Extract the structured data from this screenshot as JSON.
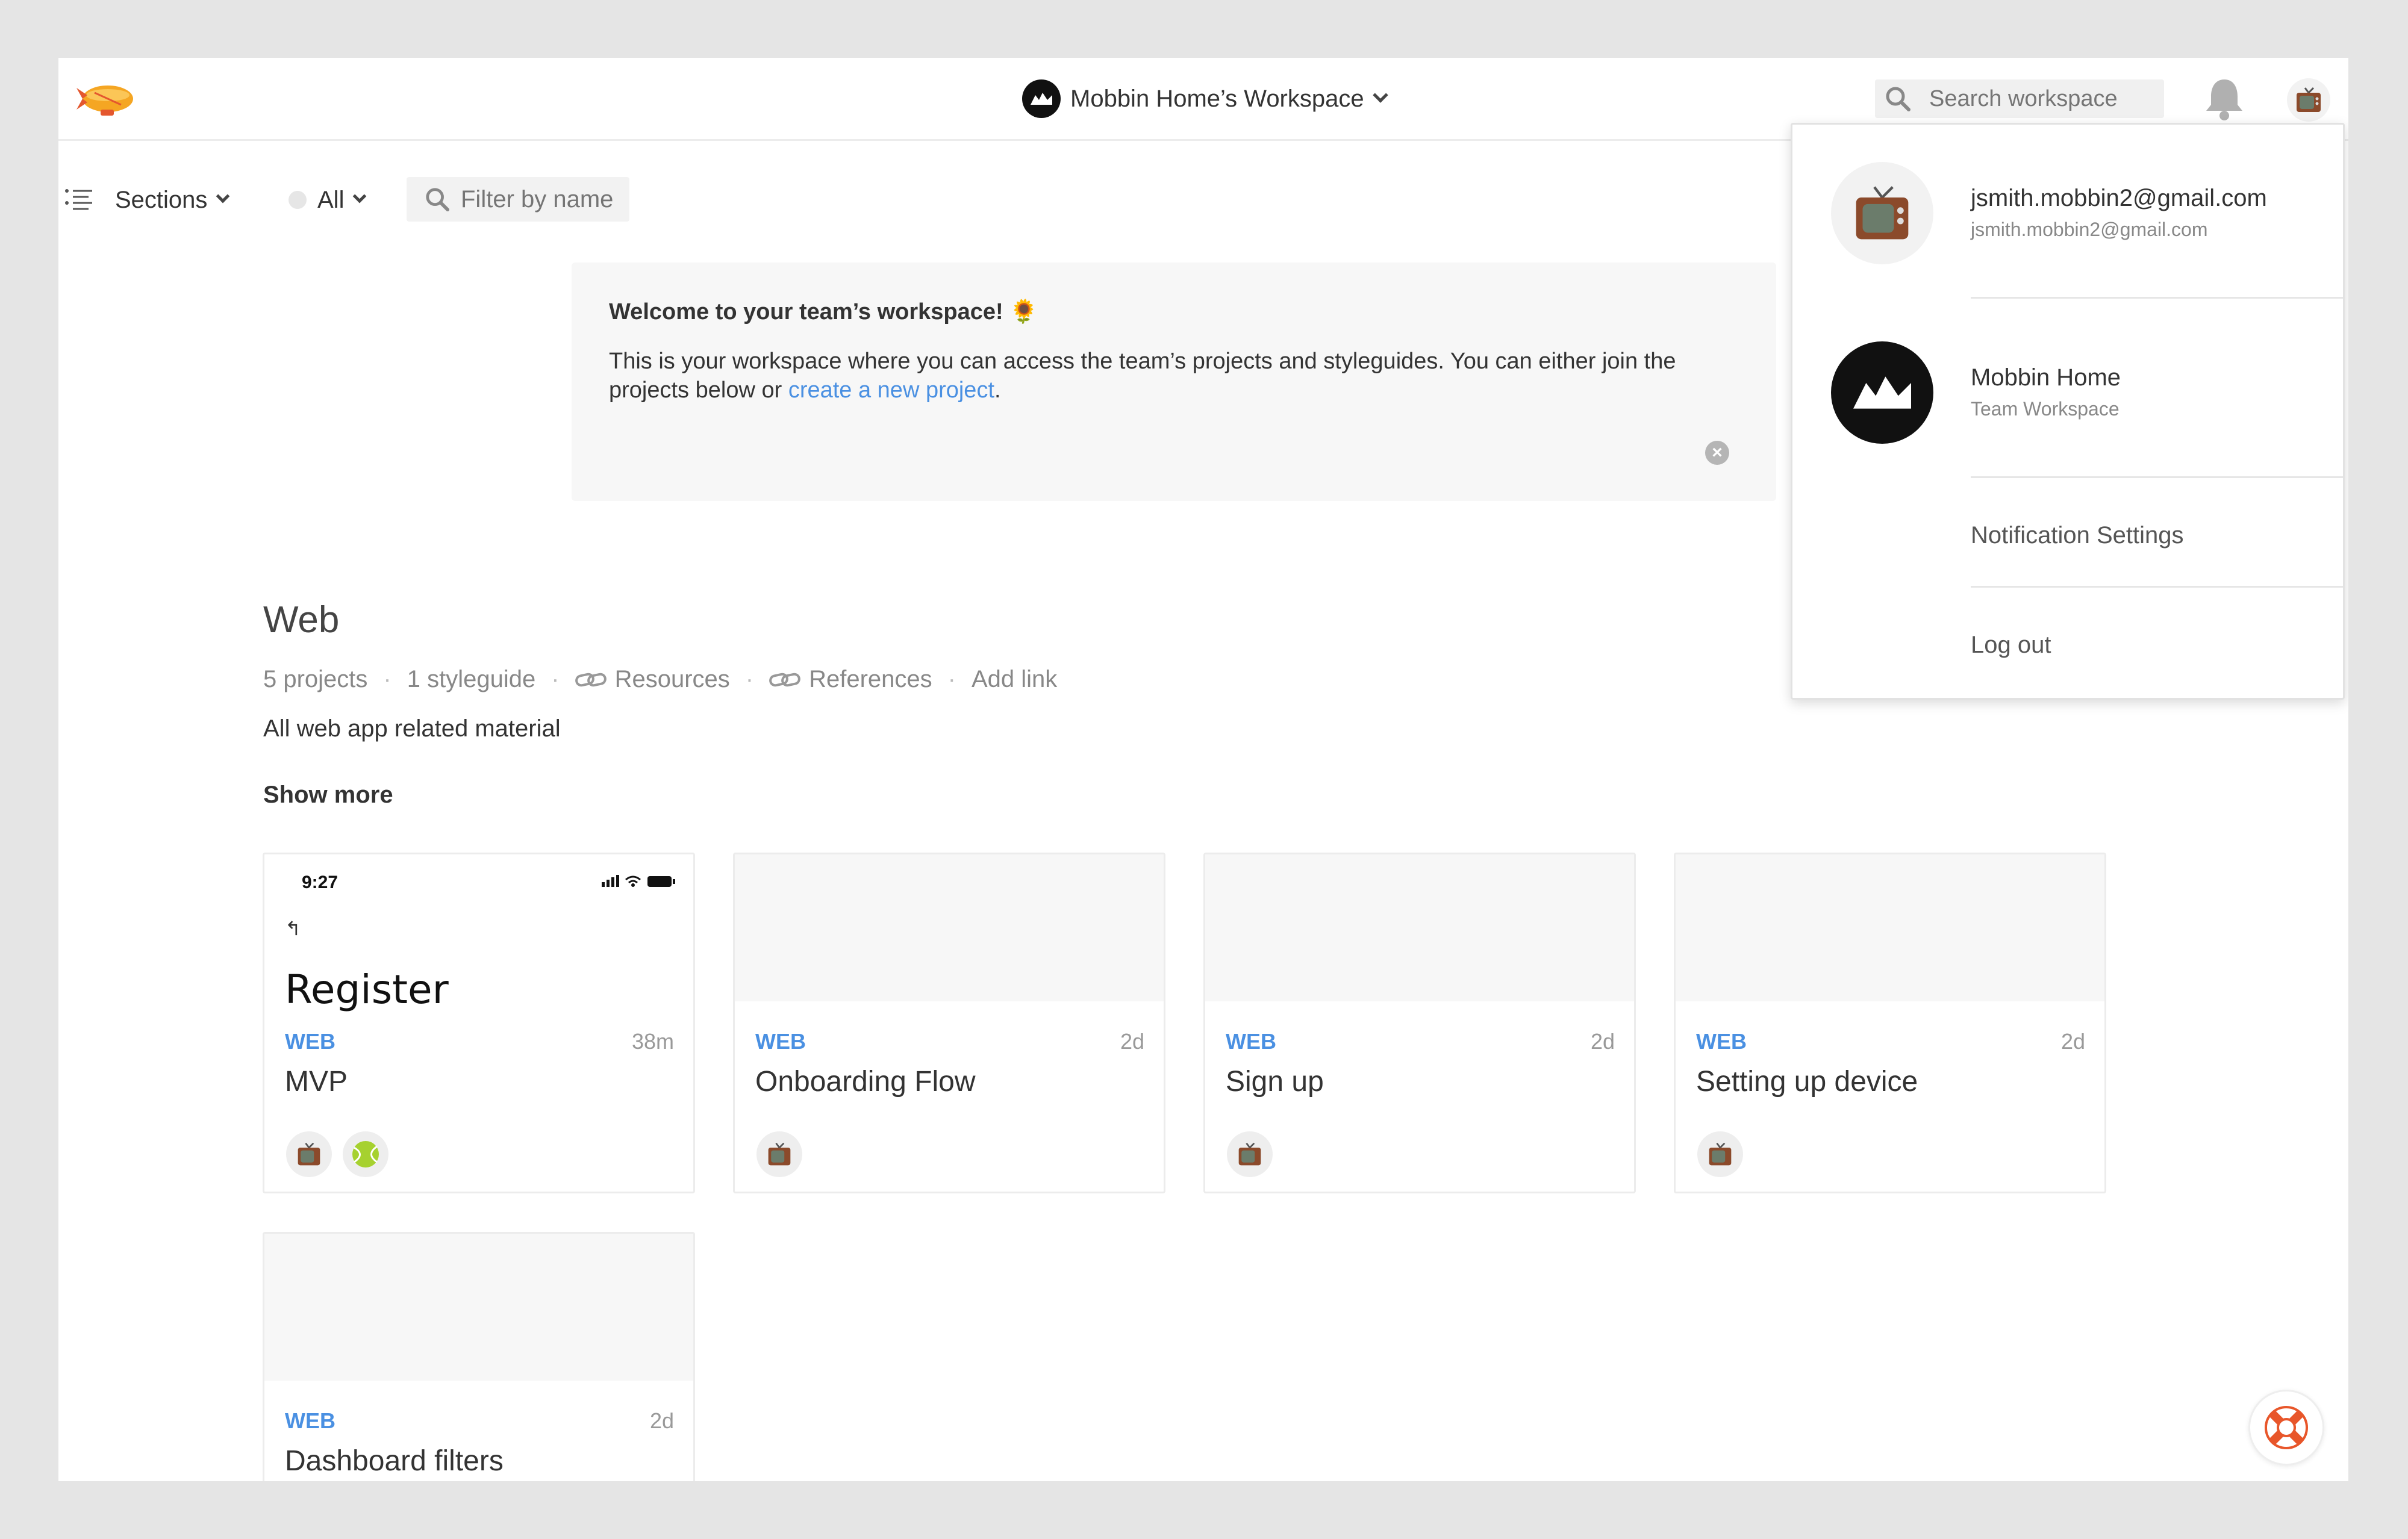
{
  "header": {
    "workspace_name": "Mobbin Home’s Workspace",
    "search_placeholder": "Search workspace"
  },
  "toolbar": {
    "sections_label": "Sections",
    "filter_all_label": "All",
    "filter_placeholder": "Filter by name"
  },
  "welcome": {
    "title": "Welcome to your team’s workspace! 🌻",
    "body_prefix": "This is your workspace where you can access the team’s projects and styleguides. You can either join the projects below or ",
    "body_link": "create a new project",
    "body_suffix": "."
  },
  "section": {
    "title": "Web",
    "projects_count": "5 projects",
    "styleguide_count": "1 styleguide",
    "resources_label": "Resources",
    "references_label": "References",
    "add_link_label": "Add link",
    "description": "All web app related material",
    "show_more_label": "Show more"
  },
  "projects": [
    {
      "category": "WEB",
      "age": "38m",
      "name": "MVP",
      "phone_time": "9:27",
      "phone_title": "Register",
      "phone_back": "↰"
    },
    {
      "category": "WEB",
      "age": "2d",
      "name": "Onboarding Flow"
    },
    {
      "category": "WEB",
      "age": "2d",
      "name": "Sign up"
    },
    {
      "category": "WEB",
      "age": "2d",
      "name": "Setting up device"
    },
    {
      "category": "WEB",
      "age": "2d",
      "name": "Dashboard filters"
    }
  ],
  "dropdown": {
    "user_email": "jsmith.mobbin2@gmail.com",
    "user_email_secondary": "jsmith.mobbin2@gmail.com",
    "workspace_name": "Mobbin Home",
    "workspace_type": "Team Workspace",
    "notification_settings_label": "Notification Settings",
    "logout_label": "Log out"
  },
  "colors": {
    "accent": "#4a90e2",
    "background": "#e5e5e5"
  },
  "icons": {
    "logo": "zeplin-blimp-icon",
    "bell": "bell-icon",
    "search": "search-icon",
    "sections": "list-icon",
    "link": "link-icon",
    "close": "close-icon",
    "help": "lifebuoy-icon",
    "avatar": "tv-icon"
  }
}
